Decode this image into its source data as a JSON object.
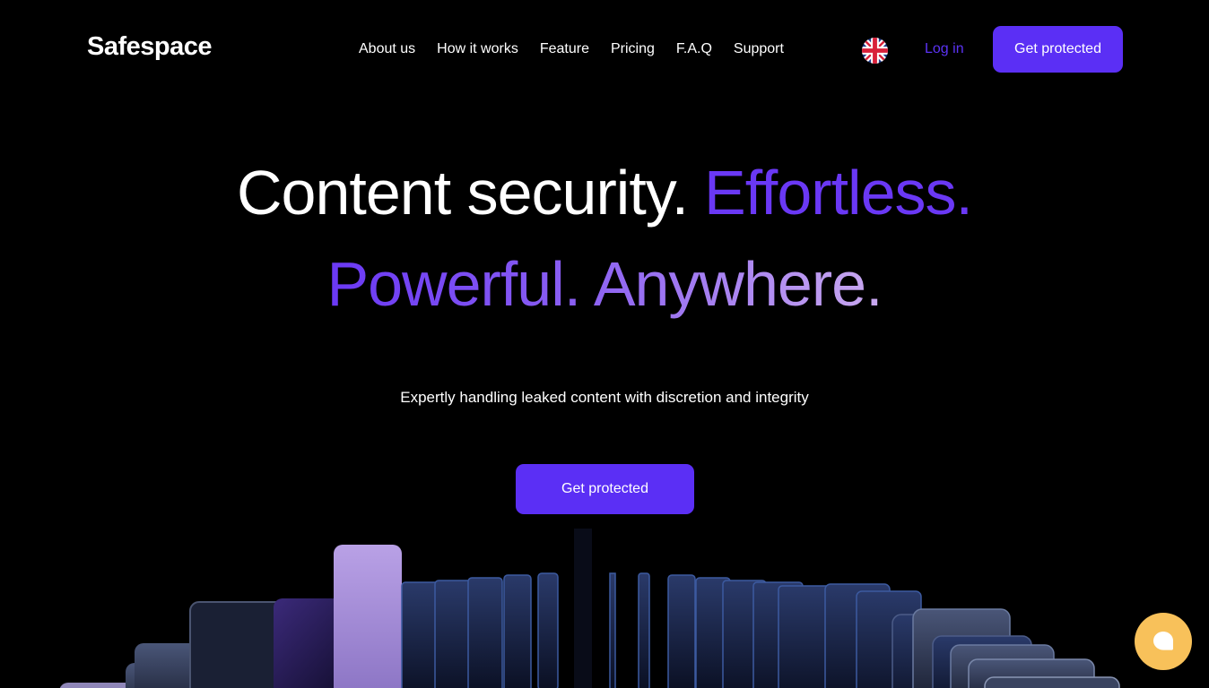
{
  "brand": {
    "name": "Safespace"
  },
  "nav": {
    "items": [
      "About us",
      "How it works",
      "Feature",
      "Pricing",
      "F.A.Q",
      "Support"
    ]
  },
  "header": {
    "language_icon": "uk-flag-icon",
    "login_label": "Log in",
    "cta_label": "Get protected"
  },
  "hero": {
    "line1_white": "Content security.",
    "line1_purple": "Effortless.",
    "line2": "Powerful. Anywhere.",
    "subtitle": "Expertly handling leaked content with discretion and integrity",
    "cta_label": "Get protected"
  },
  "chat": {
    "icon": "chat-bubble-icon"
  },
  "colors": {
    "accent": "#5b2ff5",
    "background": "#000000",
    "chat": "#f8c15a",
    "gradient_end": "#c9a9f0"
  }
}
